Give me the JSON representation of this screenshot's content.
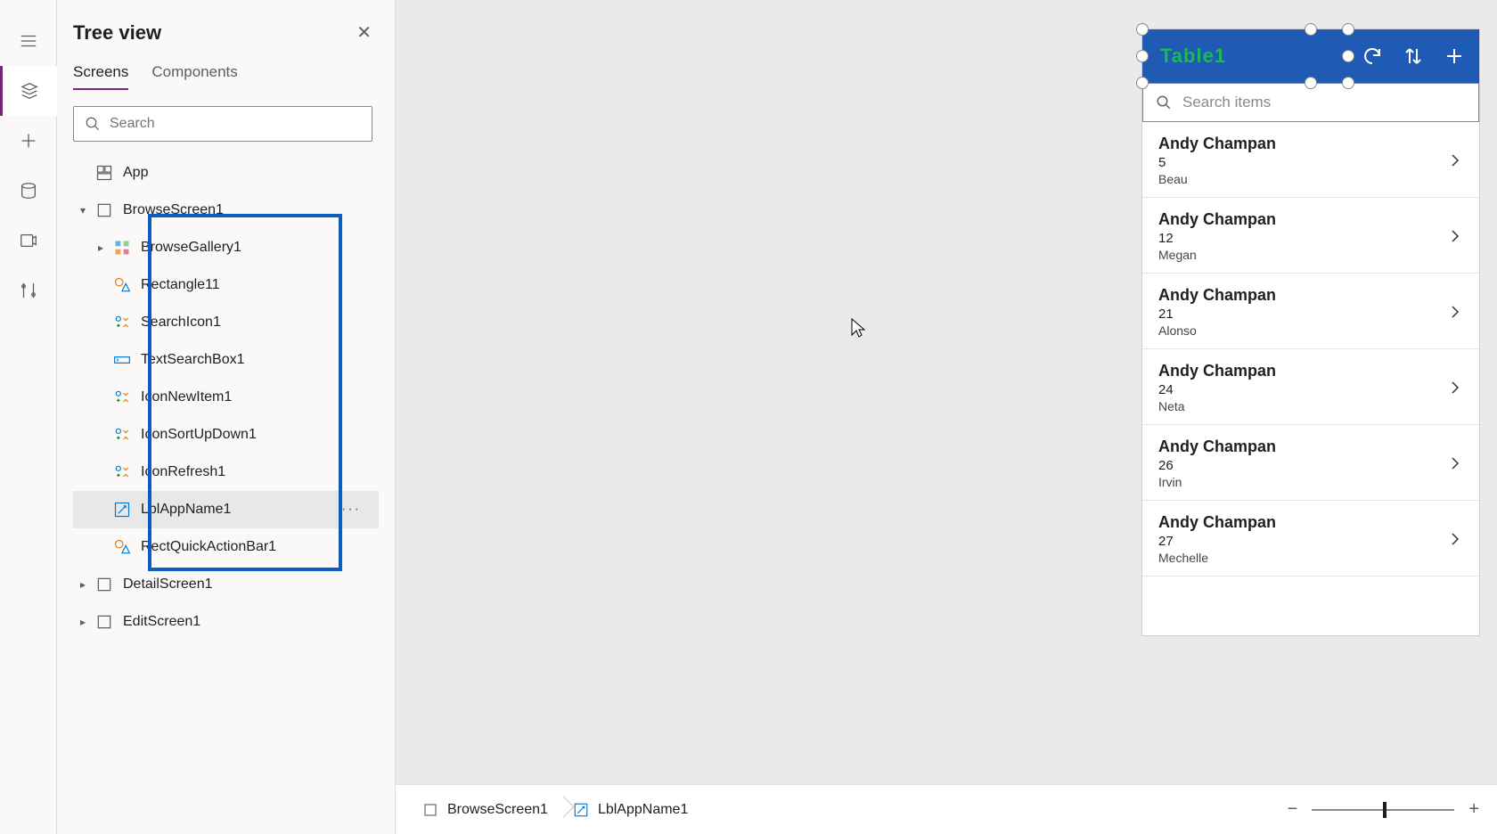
{
  "panel": {
    "title": "Tree view",
    "tabs": {
      "screens": "Screens",
      "components": "Components"
    },
    "search_placeholder": "Search",
    "app_label": "App",
    "screens": [
      {
        "name": "BrowseScreen1",
        "expanded": true
      },
      {
        "name": "DetailScreen1",
        "expanded": false
      },
      {
        "name": "EditScreen1",
        "expanded": false
      }
    ],
    "browse_children": [
      {
        "name": "BrowseGallery1",
        "kind": "gallery"
      },
      {
        "name": "Rectangle11",
        "kind": "shape"
      },
      {
        "name": "SearchIcon1",
        "kind": "icon"
      },
      {
        "name": "TextSearchBox1",
        "kind": "textbox"
      },
      {
        "name": "IconNewItem1",
        "kind": "icon"
      },
      {
        "name": "IconSortUpDown1",
        "kind": "icon"
      },
      {
        "name": "IconRefresh1",
        "kind": "icon"
      },
      {
        "name": "LblAppName1",
        "kind": "label",
        "selected": true
      },
      {
        "name": "RectQuickActionBar1",
        "kind": "shape"
      }
    ]
  },
  "phone": {
    "header_title": "Table1",
    "search_placeholder": "Search items",
    "items": [
      {
        "title": "Andy Champan",
        "num": "5",
        "sub": "Beau"
      },
      {
        "title": "Andy Champan",
        "num": "12",
        "sub": "Megan"
      },
      {
        "title": "Andy Champan",
        "num": "21",
        "sub": "Alonso"
      },
      {
        "title": "Andy Champan",
        "num": "24",
        "sub": "Neta"
      },
      {
        "title": "Andy Champan",
        "num": "26",
        "sub": "Irvin"
      },
      {
        "title": "Andy Champan",
        "num": "27",
        "sub": "Mechelle"
      }
    ]
  },
  "footer": {
    "crumb1": "BrowseScreen1",
    "crumb2": "LblAppName1"
  }
}
